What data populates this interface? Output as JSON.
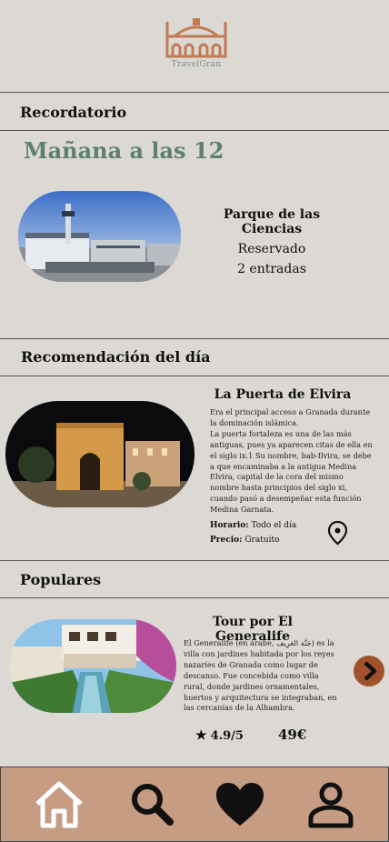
{
  "app": {
    "brand_name": "TravelGran"
  },
  "reminder": {
    "section_title": "Recordatorio",
    "time": "Mañana a las 12",
    "place": "Parque de las Ciencias",
    "status": "Reservado",
    "tickets": "2 entradas"
  },
  "recommendation": {
    "section_title": "Recomendación del día",
    "title": "La Puerta de Elvira",
    "desc_1": "Era el principal acceso a Granada durante la dominación islámica.",
    "desc_2": "La puerta fortaleza es una de las más antiguas, pues ya aparecen citas de ella en el siglo ix.1 Su nombre, bab-Ilvira, se debe a que encaminaba a la antigua Medina Elvira, capital de la cora del mismo nombre hasta principios del siglo xi, cuando pasó a desempeñar esta función Medina Garnata.",
    "hours_label": "Horario:",
    "hours_value": "Todo el día",
    "price_label": "Precio:",
    "price_value": "Gratuito",
    "pin_icon": "map-pin-icon"
  },
  "popular": {
    "section_title": "Populares",
    "title": "Tour por El Generalife",
    "desc": "El Generalife (en árabe, جَنَّة العَرِيف) es la villa con jardines habitada por los reyes nazaríes de Granada como lugar de descanso. Fue concebida como villa rural, donde jardines ornamentales, huertos y arquitectura se integraban, en las cercanías de la Alhambra.",
    "rating": "4.9/5",
    "price": "49€",
    "next_icon": "chevron-right-icon"
  },
  "nav": {
    "items": [
      "home-icon",
      "search-icon",
      "heart-icon",
      "profile-icon"
    ]
  },
  "colors": {
    "background": "#dcd8d4",
    "accent_green": "#5d8070",
    "logo_brown": "#c17a53",
    "nav_bg": "#c69c83",
    "next_button": "#a0522d"
  }
}
